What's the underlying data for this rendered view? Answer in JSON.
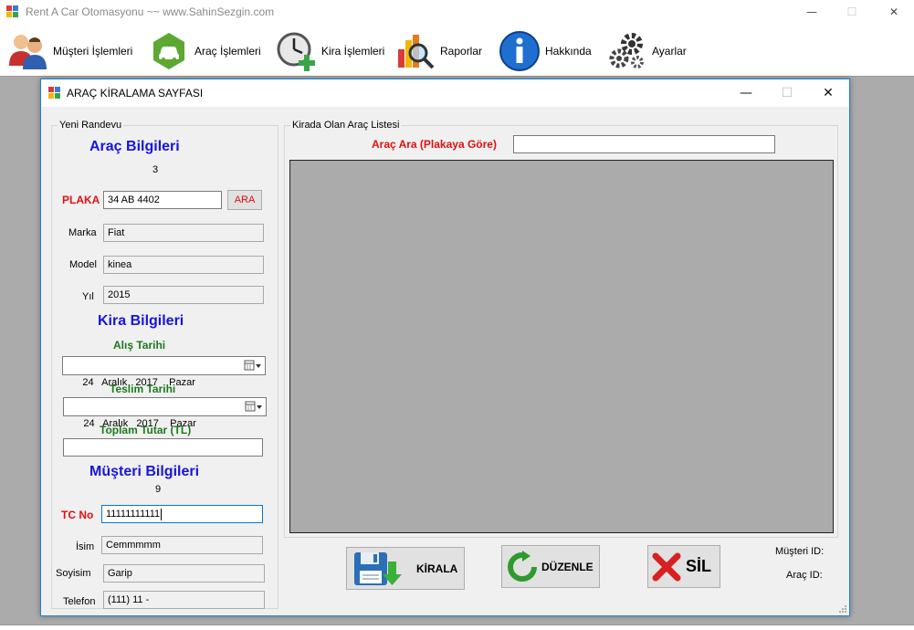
{
  "main_window": {
    "title": "Rent A Car Otomasyonu ~~ www.SahinSezgin.com",
    "controls": {
      "minimize": "—",
      "maximize": "☐",
      "close": "✕"
    }
  },
  "menu": {
    "items": [
      {
        "label": "Müşteri İşlemleri",
        "icon": "customers-icon"
      },
      {
        "label": "Araç İşlemleri",
        "icon": "car-icon"
      },
      {
        "label": "Kira İşlemleri",
        "icon": "clock-add-icon"
      },
      {
        "label": "Raporlar",
        "icon": "report-magnifier-icon"
      },
      {
        "label": "Hakkında",
        "icon": "info-icon"
      },
      {
        "label": "Ayarlar",
        "icon": "gears-icon"
      }
    ]
  },
  "dialog": {
    "title": "ARAÇ KİRALAMA SAYFASI",
    "controls": {
      "minimize": "—",
      "maximize": "☐",
      "close": "✕"
    }
  },
  "appointment": {
    "group_title": "Yeni Randevu",
    "vehicle_heading": "Araç Bilgileri",
    "vehicle_id": "3",
    "plate_label": "PLAKA",
    "plate_value": "34 AB 4402",
    "search_button": "ARA",
    "brand_label": "Marka",
    "brand_value": "Fiat",
    "model_label": "Model",
    "model_value": "kinea",
    "year_label": "Yıl",
    "year_value": "2015",
    "rental_heading": "Kira Bilgileri",
    "pickup_label": "Alış Tarihi",
    "pickup_value": "24   Aralık   2017    Pazar",
    "return_label": "Teslim Tarihi",
    "return_value": "24   Aralık   2017    Pazar",
    "total_label": "Toplam Tutar (TL)",
    "total_value": "",
    "customer_heading": "Müşteri Bilgileri",
    "customer_id": "9",
    "tc_label": "TC No",
    "tc_value": "11111111111",
    "name_label": "İsim",
    "name_value": "Cemmmmm",
    "surname_label": "Soyisim",
    "surname_value": "Garip",
    "phone_label": "Telefon",
    "phone_value": "(111) 11 -"
  },
  "rented_list": {
    "group_title": "Kirada Olan Araç Listesi",
    "search_label": "Araç Ara (Plakaya Göre)",
    "search_value": ""
  },
  "actions": {
    "rent_button": "KİRALA",
    "edit_button": "DÜZENLE",
    "delete_button": "SİL",
    "customer_id_label": "Müşteri ID:",
    "vehicle_id_label": "Araç ID:"
  },
  "colors": {
    "heading_blue": "#1515e0",
    "label_red": "#e01010",
    "label_green": "#1d7a1d",
    "window_border": "#1883d7"
  }
}
